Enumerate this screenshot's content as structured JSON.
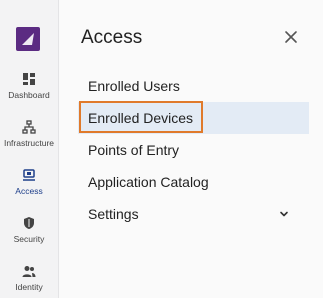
{
  "rail": {
    "logo_icon": "brand-logo",
    "items": [
      {
        "label": "Dashboard",
        "icon": "dashboard-icon",
        "active": false
      },
      {
        "label": "Infrastructure",
        "icon": "infrastructure-icon",
        "active": false
      },
      {
        "label": "Access",
        "icon": "access-icon",
        "active": true
      },
      {
        "label": "Security",
        "icon": "security-icon",
        "active": false
      },
      {
        "label": "Identity",
        "icon": "identity-icon",
        "active": false
      }
    ]
  },
  "panel": {
    "title": "Access",
    "close_icon": "close-icon",
    "menu": [
      {
        "label": "Enrolled Users"
      },
      {
        "label": "Enrolled Devices",
        "selected": true
      },
      {
        "label": "Points of Entry"
      },
      {
        "label": "Application Catalog"
      },
      {
        "label": "Settings",
        "expandable": true
      }
    ]
  },
  "colors": {
    "brand": "#5b2b82",
    "accent": "#1d3e8a",
    "selected_bg": "#e3ebf5",
    "highlight_border": "#e07a2b"
  }
}
